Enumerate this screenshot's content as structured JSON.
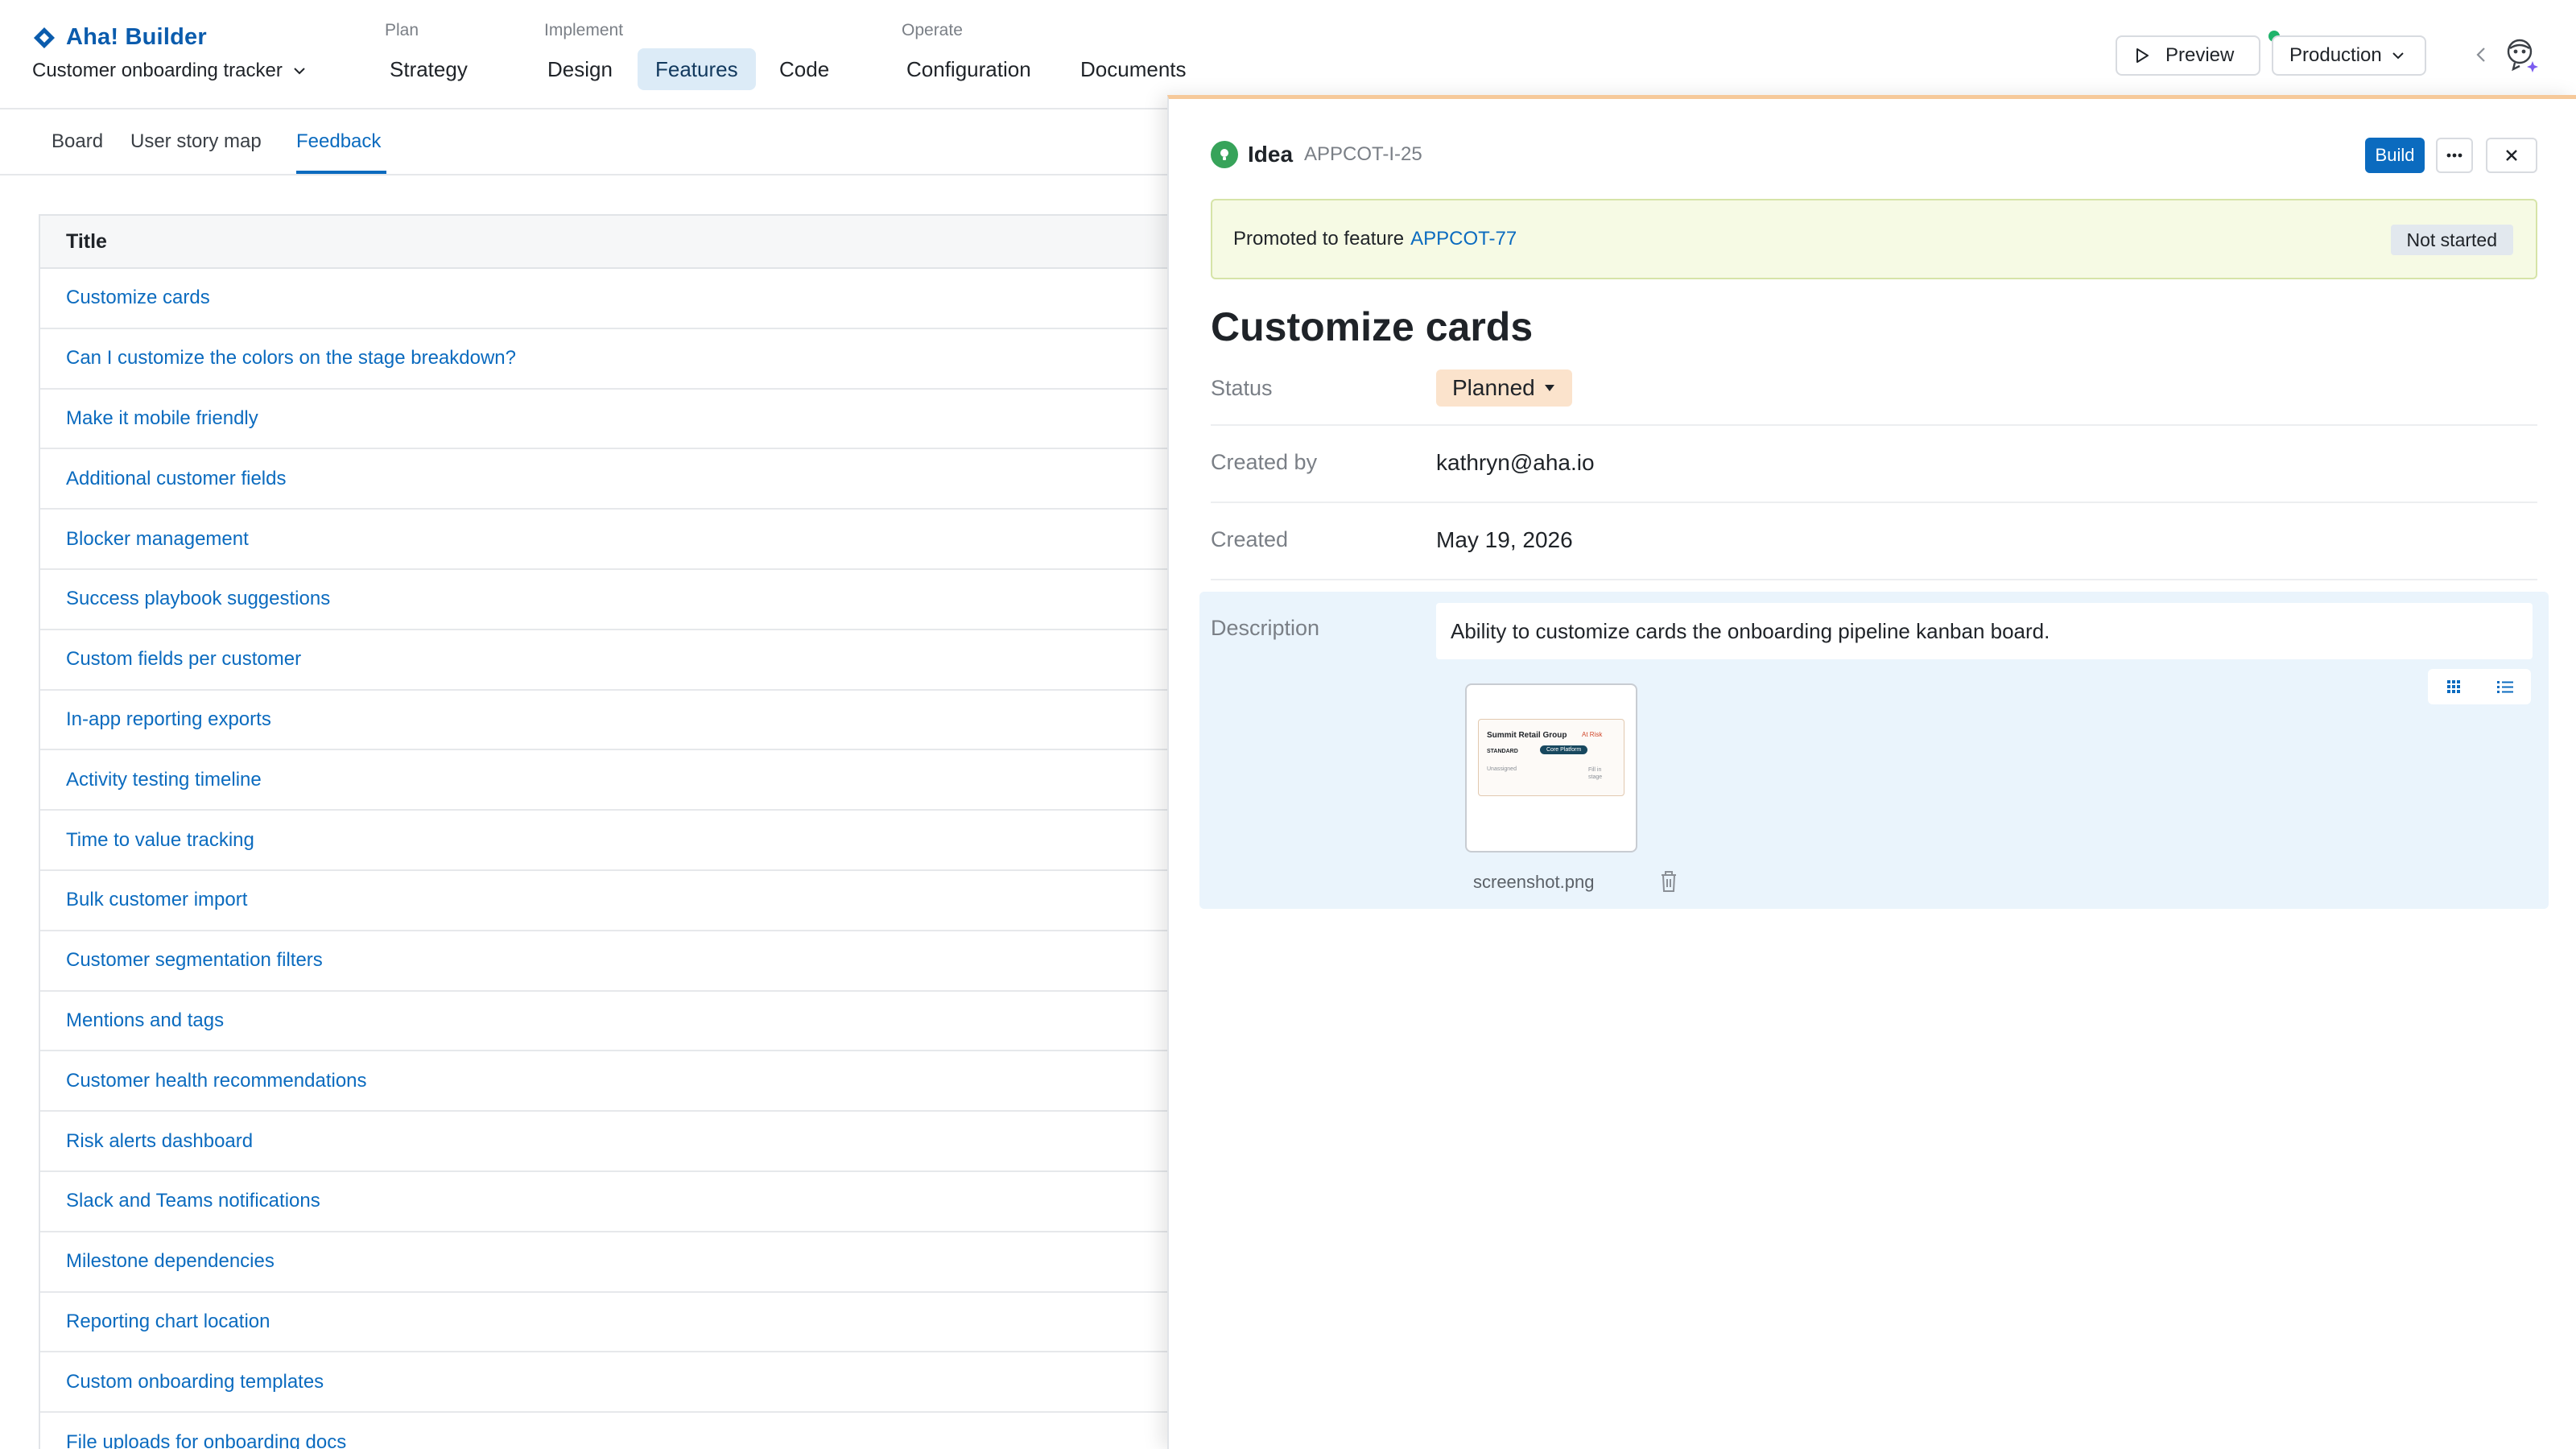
{
  "brand": {
    "name": "Aha! Builder"
  },
  "project": {
    "name": "Customer onboarding tracker"
  },
  "nav": {
    "groups": [
      {
        "label": "Plan"
      },
      {
        "label": "Implement"
      },
      {
        "label": "Operate"
      }
    ],
    "items": [
      {
        "label": "Strategy",
        "active": false
      },
      {
        "label": "Design",
        "active": false
      },
      {
        "label": "Features",
        "active": true
      },
      {
        "label": "Code",
        "active": false
      },
      {
        "label": "Configuration",
        "active": false
      },
      {
        "label": "Documents",
        "active": false
      }
    ]
  },
  "toolbar": {
    "preview_label": "Preview",
    "environment": "Production",
    "environment_status_color": "#1fb36b"
  },
  "subtabs": [
    {
      "label": "Board",
      "active": false
    },
    {
      "label": "User story map",
      "active": false
    },
    {
      "label": "Feedback",
      "active": true
    }
  ],
  "table": {
    "header": "Title",
    "rows": [
      "Customize cards",
      "Can I customize the colors on the stage breakdown?",
      "Make it mobile friendly",
      "Additional customer fields",
      "Blocker management",
      "Success playbook suggestions",
      "Custom fields per customer",
      "In-app reporting exports",
      "Activity testing timeline",
      "Time to value tracking",
      "Bulk customer import",
      "Customer segmentation filters",
      "Mentions and tags",
      "Customer health recommendations",
      "Risk alerts dashboard",
      "Slack and Teams notifications",
      "Milestone dependencies",
      "Reporting chart location",
      "Custom onboarding templates",
      "File uploads for onboarding docs"
    ]
  },
  "drawer": {
    "record_type": "Idea",
    "reference": "APPCOT-I-25",
    "build_label": "Build",
    "promotion": {
      "text": "Promoted to feature",
      "feature_ref": "APPCOT-77",
      "feature_status": "Not started"
    },
    "title": "Customize cards",
    "fields": {
      "status_label": "Status",
      "status_value": "Planned",
      "created_by_label": "Created by",
      "created_by_value": "kathryn@aha.io",
      "created_label": "Created",
      "created_value": "May 19, 2026"
    },
    "description": {
      "label": "Description",
      "text": "Ability to customize cards the onboarding pipeline kanban board."
    },
    "attachment": {
      "filename": "screenshot.png",
      "preview": {
        "company": "Summit Retail Group",
        "risk": "At Risk",
        "tier": "STANDARD",
        "plan": "Core Platform",
        "owner": "Unassigned",
        "stage": "Fill in stage"
      }
    }
  },
  "colors": {
    "brand": "#0b5cad",
    "link": "#0b6bbf",
    "active_nav_bg": "#dcebf7",
    "idea_badge": "#37a35a",
    "planned_pill": "#fbe3cc",
    "promotion_bg": "#f6fae4",
    "description_bg": "#eaf4fc",
    "drawer_accent": "#f6c99a"
  }
}
